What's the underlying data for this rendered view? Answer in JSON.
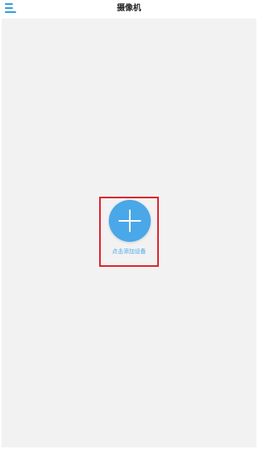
{
  "header": {
    "title": "摄像机",
    "menu_icon": "menu-icon"
  },
  "main": {
    "add_device_label": "点击添加设备",
    "add_icon": "plus-icon"
  },
  "colors": {
    "accent": "#2b9be0",
    "button": "#4aa8e8",
    "background": "#f2f2f2",
    "highlight_border": "#e0202a"
  }
}
